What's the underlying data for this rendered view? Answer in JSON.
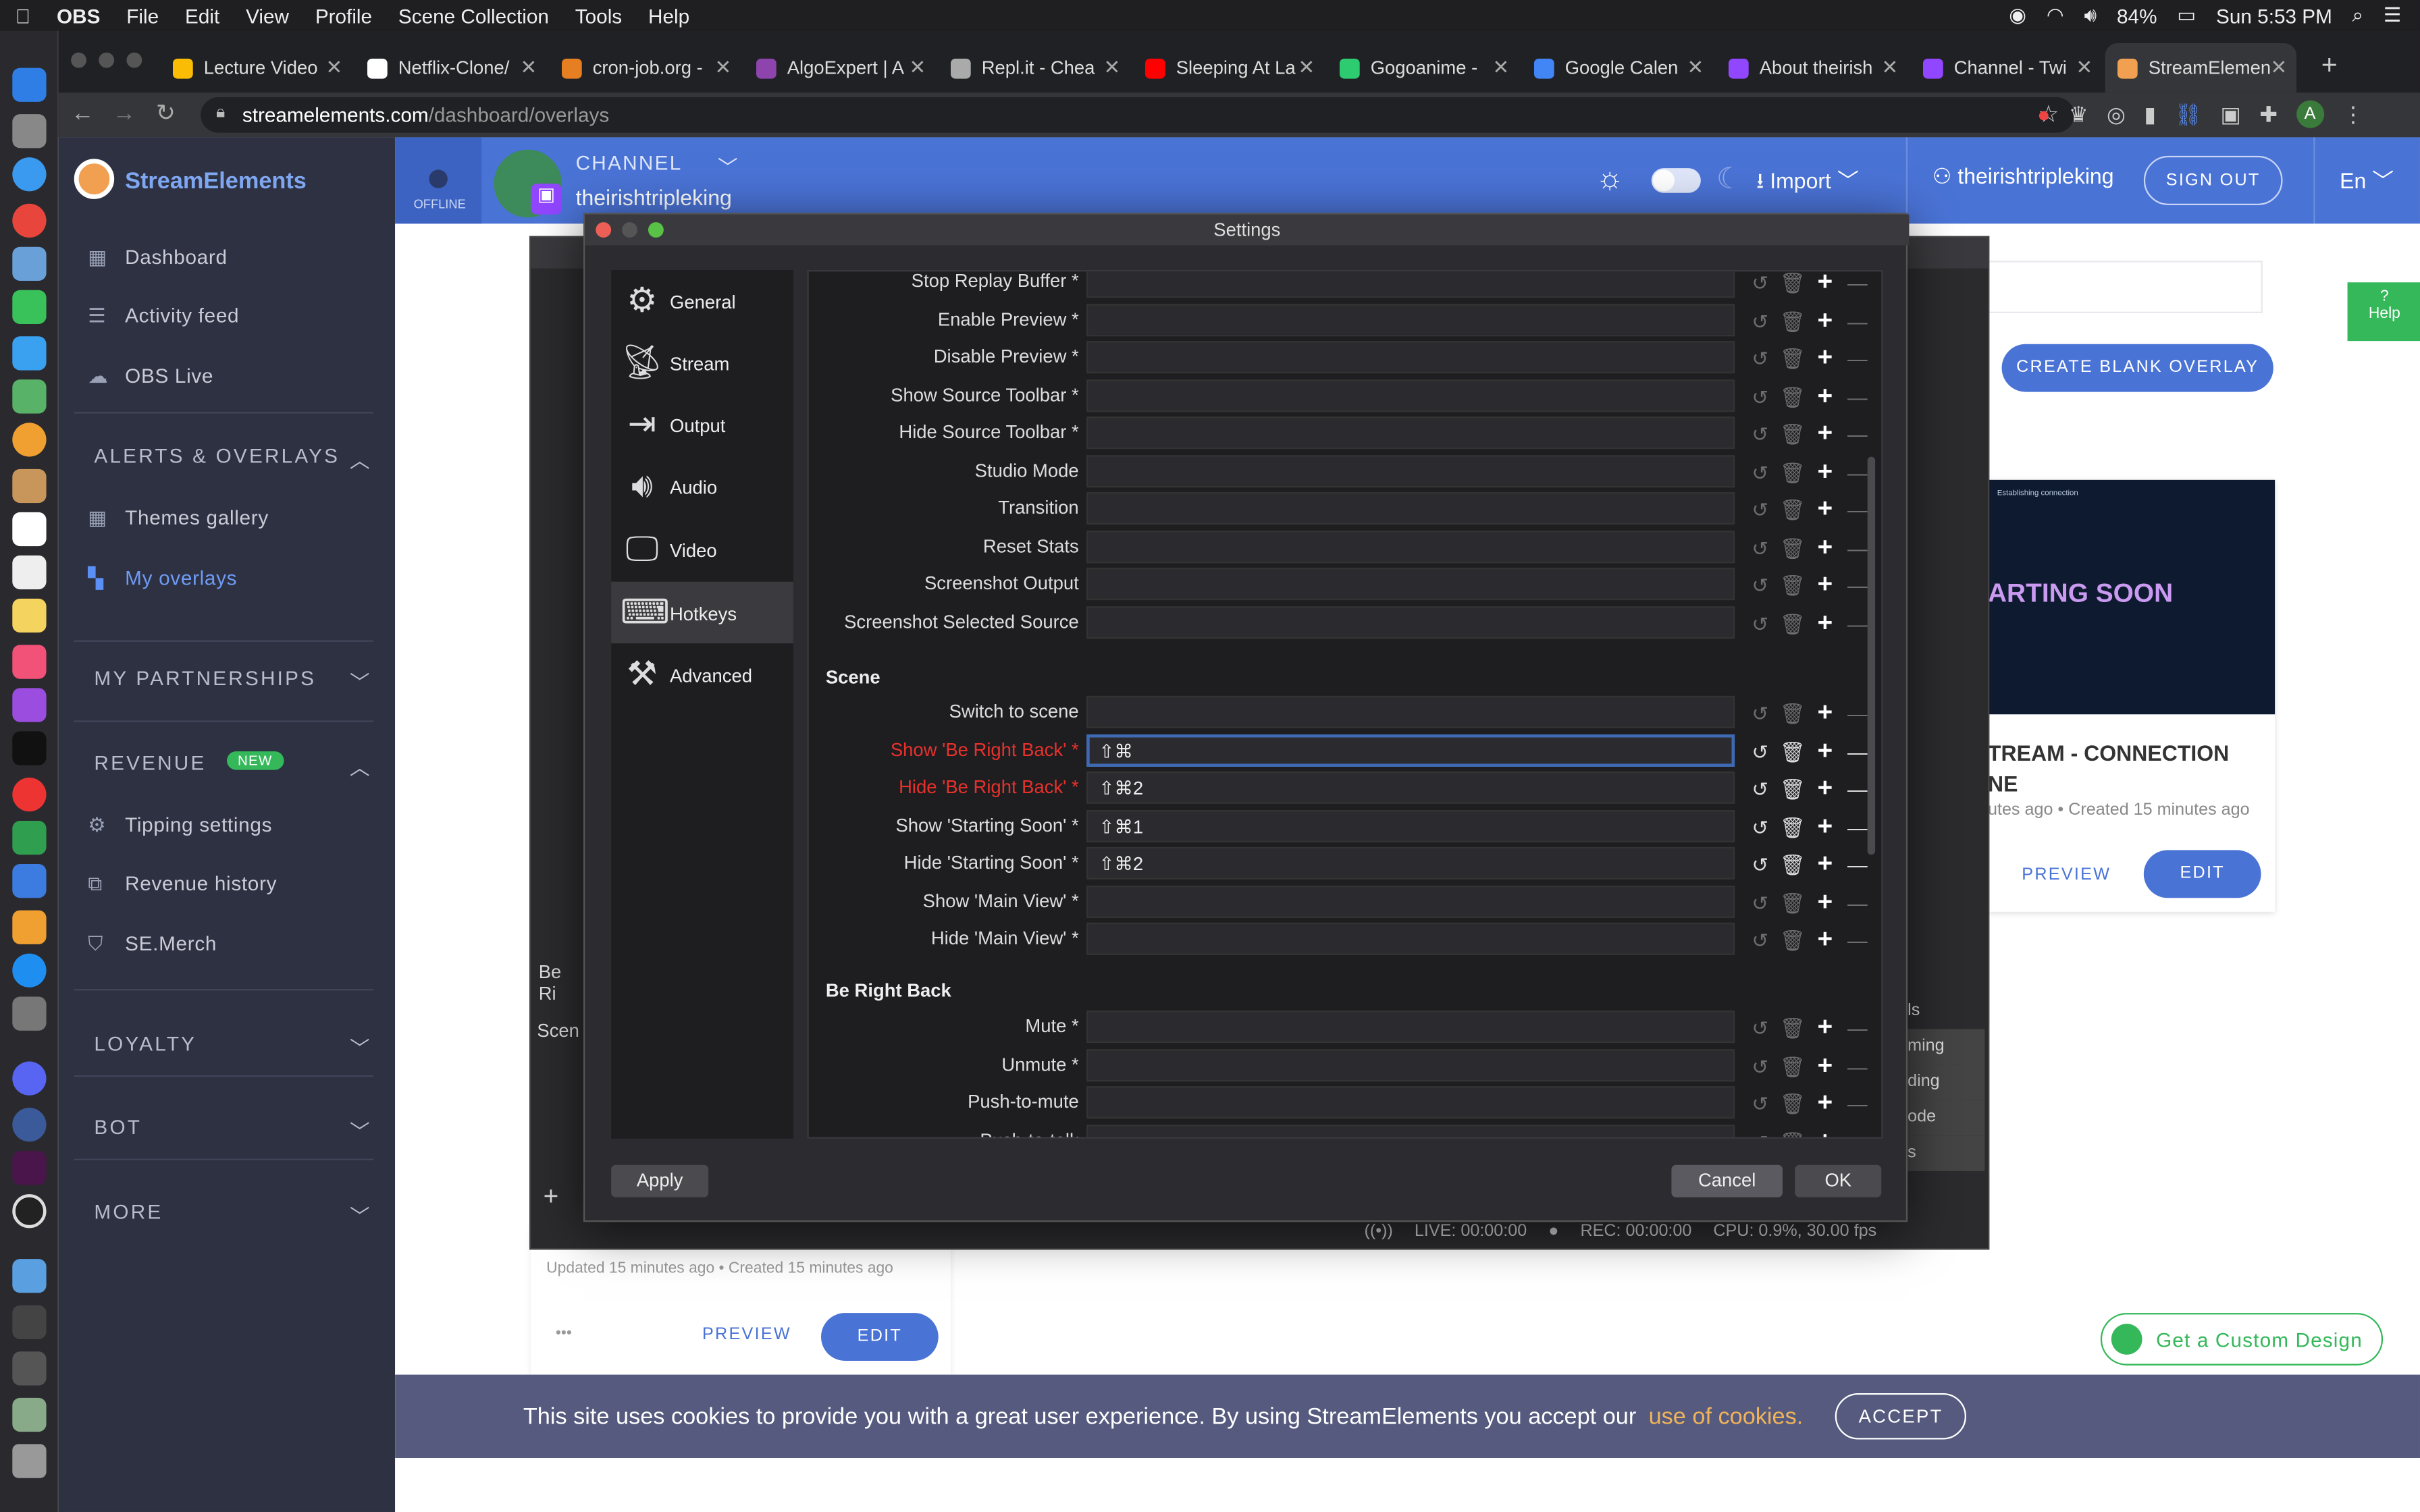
{
  "menubar": {
    "app": "OBS",
    "items": [
      "File",
      "Edit",
      "View",
      "Profile",
      "Scene Collection",
      "Tools",
      "Help"
    ],
    "battery": "84%",
    "clock": "Sun 5:53 PM"
  },
  "browser": {
    "tabs": [
      "Lecture Video",
      "Netflix-Clone/",
      "cron-job.org -",
      "AlgoExpert | A",
      "Repl.it - Chea",
      "Sleeping At La",
      "Gogoanime -",
      "Google Calen",
      "About theirish",
      "Channel - Twi",
      "StreamElemen"
    ],
    "tab_colors": [
      "#fbbc05",
      "#ffffff",
      "#e67e22",
      "#8e44ad",
      "#aaaaaa",
      "#ff0000",
      "#2ecc71",
      "#4285f4",
      "#9146ff",
      "#9146ff",
      "#f0a050"
    ],
    "url_host": "streamelements.com",
    "url_path": "/dashboard/overlays",
    "profile": "A"
  },
  "site": {
    "brand": "StreamElements",
    "nav": {
      "dashboard": "Dashboard",
      "activity": "Activity feed",
      "obslive": "OBS Live",
      "alerts": "ALERTS & OVERLAYS",
      "themes": "Themes gallery",
      "overlays": "My overlays",
      "partnerships": "MY PARTNERSHIPS",
      "revenue": "REVENUE",
      "new_badge": "NEW",
      "tipping": "Tipping settings",
      "revhist": "Revenue history",
      "merch": "SE.Merch",
      "loyalty": "LOYALTY",
      "bot": "BOT",
      "more": "MORE"
    },
    "header": {
      "status": "OFFLINE",
      "channel_label": "CHANNEL",
      "channel_name": "theirishtripleking",
      "import": "Import",
      "user": "theirishtripleking",
      "signout": "SIGN OUT",
      "lang": "En"
    },
    "help": "Help",
    "create_blank": "CREATE BLANK OVERLAY",
    "card1": {
      "title_line1": "TREAM - CONNECTION",
      "title_line2": "NE",
      "meta_left": "utes ago",
      "meta_right": "Created 15 minutes ago",
      "preview": "PREVIEW",
      "edit": "EDIT",
      "thumb_text": "ARTING SOON",
      "thumb_small": "Establishing connection"
    },
    "card2": {
      "meta": "Updated 15 minutes ago  •  Created 15 minutes ago",
      "preview": "PREVIEW",
      "edit": "EDIT",
      "dots": "•••"
    },
    "custom_design": "Get a Custom Design",
    "cookie": {
      "text": "This site uses cookies to provide you with a great user experience. By using StreamElements you accept our",
      "link": "use of cookies.",
      "accept": "ACCEPT"
    }
  },
  "obs": {
    "status": {
      "live": "LIVE: 00:00:00",
      "rec": "REC: 00:00:00",
      "cpu": "CPU: 0.9%, 30.00 fps"
    },
    "behind": {
      "be_right": "Be Ri",
      "scene": "Scen",
      "r1": "ls",
      "r2": "ming",
      "r3": "ding",
      "r4": "ode",
      "r5": "s"
    }
  },
  "settings": {
    "title": "Settings",
    "nav": [
      "General",
      "Stream",
      "Output",
      "Audio",
      "Video",
      "Hotkeys",
      "Advanced"
    ],
    "rows_top": [
      {
        "label": "Stop Replay Buffer *",
        "value": ""
      },
      {
        "label": "Enable Preview *",
        "value": ""
      },
      {
        "label": "Disable Preview *",
        "value": ""
      },
      {
        "label": "Show Source Toolbar *",
        "value": ""
      },
      {
        "label": "Hide Source Toolbar *",
        "value": ""
      },
      {
        "label": "Studio Mode",
        "value": ""
      },
      {
        "label": "Transition",
        "value": ""
      },
      {
        "label": "Reset Stats",
        "value": ""
      },
      {
        "label": "Screenshot Output",
        "value": ""
      },
      {
        "label": "Screenshot Selected Source",
        "value": ""
      }
    ],
    "group_scene": "Scene",
    "rows_scene": [
      {
        "label": "Switch to scene",
        "value": ""
      },
      {
        "label": "Show 'Be Right Back' *",
        "value": "⇧⌘"
      },
      {
        "label": "Hide 'Be Right Back' *",
        "value": "⇧⌘2"
      },
      {
        "label": "Show 'Starting Soon' *",
        "value": "⇧⌘1"
      },
      {
        "label": "Hide 'Starting Soon' *",
        "value": "⇧⌘2"
      },
      {
        "label": "Show 'Main View' *",
        "value": ""
      },
      {
        "label": "Hide 'Main View' *",
        "value": ""
      }
    ],
    "group_brb": "Be Right Back",
    "rows_brb": [
      {
        "label": "Mute *",
        "value": ""
      },
      {
        "label": "Unmute *",
        "value": ""
      },
      {
        "label": "Push-to-mute",
        "value": ""
      },
      {
        "label": "Push-to-talk",
        "value": ""
      }
    ],
    "apply": "Apply",
    "cancel": "Cancel",
    "ok": "OK"
  }
}
